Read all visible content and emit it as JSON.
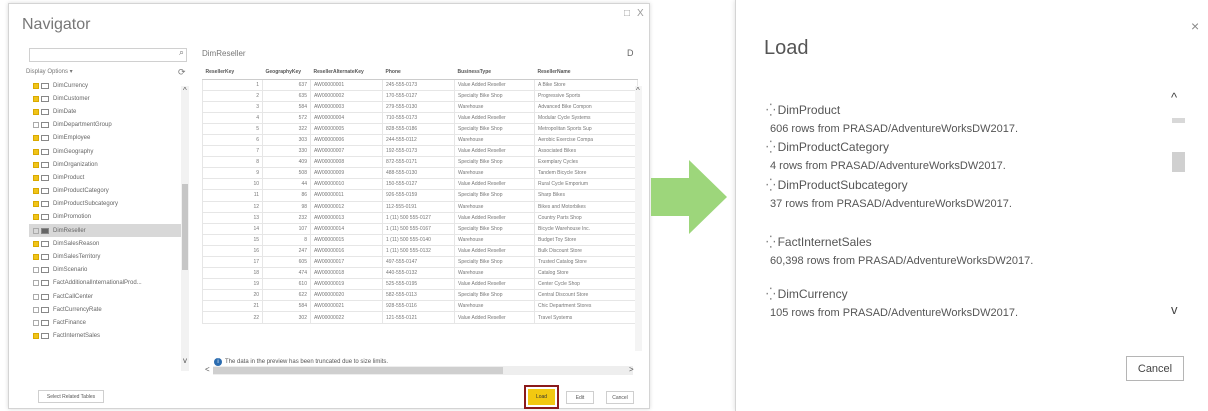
{
  "navigator": {
    "title": "Navigator",
    "window_buttons": [
      "□",
      "X"
    ],
    "display_options": "Display Options ▾",
    "tree": [
      {
        "label": "DimCurrency",
        "checked": true
      },
      {
        "label": "DimCustomer",
        "checked": true
      },
      {
        "label": "DimDate",
        "checked": true
      },
      {
        "label": "DimDepartmentGroup",
        "checked": false
      },
      {
        "label": "DimEmployee",
        "checked": true
      },
      {
        "label": "DimGeography",
        "checked": true
      },
      {
        "label": "DimOrganization",
        "checked": true
      },
      {
        "label": "DimProduct",
        "checked": true
      },
      {
        "label": "DimProductCategory",
        "checked": true
      },
      {
        "label": "DimProductSubcategory",
        "checked": true
      },
      {
        "label": "DimPromotion",
        "checked": true
      },
      {
        "label": "DimReseller",
        "checked": false,
        "selected": true
      },
      {
        "label": "DimSalesReason",
        "checked": true
      },
      {
        "label": "DimSalesTerritory",
        "checked": true
      },
      {
        "label": "DimScenario",
        "checked": false
      },
      {
        "label": "FactAdditionalInternationalProd...",
        "checked": false
      },
      {
        "label": "FactCallCenter",
        "checked": false
      },
      {
        "label": "FactCurrencyRate",
        "checked": false
      },
      {
        "label": "FactFinance",
        "checked": false
      },
      {
        "label": "FactInternetSales",
        "checked": true
      }
    ],
    "preview_title": "DimReseller",
    "columns": [
      "ResellerKey",
      "GeographyKey",
      "ResellerAlternateKey",
      "Phone",
      "BusinessType",
      "ResellerName"
    ],
    "rows": [
      [
        "1",
        "637",
        "AW00000001",
        "245-555-0173",
        "Value Added Reseller",
        "A Bike Store"
      ],
      [
        "2",
        "635",
        "AW00000002",
        "170-555-0127",
        "Specialty Bike Shop",
        "Progressive Sports"
      ],
      [
        "3",
        "584",
        "AW00000003",
        "279-555-0130",
        "Warehouse",
        "Advanced Bike Compon"
      ],
      [
        "4",
        "572",
        "AW00000004",
        "710-555-0173",
        "Value Added Reseller",
        "Modular Cycle Systems"
      ],
      [
        "5",
        "322",
        "AW00000005",
        "828-555-0186",
        "Specialty Bike Shop",
        "Metropolitan Sports Sup"
      ],
      [
        "6",
        "303",
        "AW00000006",
        "244-555-0112",
        "Warehouse",
        "Aerobic Exercise Compa"
      ],
      [
        "7",
        "330",
        "AW00000007",
        "192-555-0173",
        "Value Added Reseller",
        "Associated Bikes"
      ],
      [
        "8",
        "409",
        "AW00000008",
        "872-555-0171",
        "Specialty Bike Shop",
        "Exemplary Cycles"
      ],
      [
        "9",
        "508",
        "AW00000009",
        "488-555-0130",
        "Warehouse",
        "Tandem Bicycle Store"
      ],
      [
        "10",
        "44",
        "AW00000010",
        "150-555-0127",
        "Value Added Reseller",
        "Rural Cycle Emporium"
      ],
      [
        "11",
        "86",
        "AW00000011",
        "926-555-0159",
        "Specialty Bike Shop",
        "Sharp Bikes"
      ],
      [
        "12",
        "98",
        "AW00000012",
        "112-555-0191",
        "Warehouse",
        "Bikes and Motorbikes"
      ],
      [
        "13",
        "232",
        "AW00000013",
        "1 (11) 500 555-0127",
        "Value Added Reseller",
        "Country Parts Shop"
      ],
      [
        "14",
        "107",
        "AW00000014",
        "1 (11) 500 555-0167",
        "Specialty Bike Shop",
        "Bicycle Warehouse Inc."
      ],
      [
        "15",
        "8",
        "AW00000015",
        "1 (11) 500 555-0140",
        "Warehouse",
        "Budget Toy Store"
      ],
      [
        "16",
        "247",
        "AW00000016",
        "1 (11) 500 555-0132",
        "Value Added Reseller",
        "Bulk Discount Store"
      ],
      [
        "17",
        "605",
        "AW00000017",
        "497-555-0147",
        "Specialty Bike Shop",
        "Trusted Catalog Store"
      ],
      [
        "18",
        "474",
        "AW00000018",
        "440-555-0132",
        "Warehouse",
        "Catalog Store"
      ],
      [
        "19",
        "610",
        "AW00000019",
        "525-555-0195",
        "Value Added Reseller",
        "Center Cycle Shop"
      ],
      [
        "20",
        "622",
        "AW00000020",
        "582-555-0113",
        "Specialty Bike Shop",
        "Central Discount Store"
      ],
      [
        "21",
        "584",
        "AW00000021",
        "928-555-0116",
        "Warehouse",
        "Chic Department Stores"
      ],
      [
        "22",
        "302",
        "AW00000022",
        "121-555-0121",
        "Value Added Reseller",
        "Travel Systems"
      ]
    ],
    "info_text": "The data in the preview has been truncated due to size limits.",
    "buttons": {
      "select_related": "Select Related Tables",
      "load": "Load",
      "edit": "Edit",
      "cancel": "Cancel"
    }
  },
  "load_dialog": {
    "title": "Load",
    "close": "×",
    "items": [
      {
        "name": "DimProduct",
        "desc": "606 rows from PRASAD/AdventureWorksDW2017."
      },
      {
        "name": "DimProductCategory",
        "desc": "4 rows from PRASAD/AdventureWorksDW2017."
      },
      {
        "name": "DimProductSubcategory",
        "desc": "37 rows from PRASAD/AdventureWorksDW2017."
      },
      {
        "name": "FactInternetSales",
        "desc": "60,398 rows from PRASAD/AdventureWorksDW2017."
      },
      {
        "name": "DimCurrency",
        "desc": "105 rows from PRASAD/AdventureWorksDW2017."
      }
    ],
    "cancel": "Cancel"
  },
  "colors": {
    "accent": "#f2c811",
    "highlight": "#8b1a1a",
    "arrow": "#9dd67b"
  },
  "icons": {
    "arrow": "right-arrow-icon",
    "spinner": "spinner-icon",
    "search": "search-icon"
  }
}
